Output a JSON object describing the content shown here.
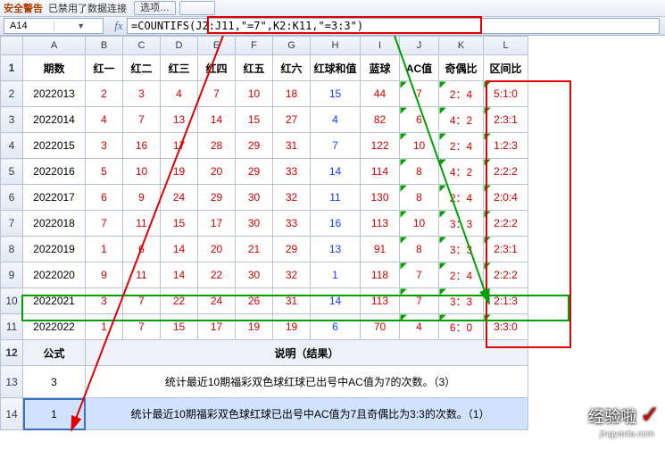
{
  "topbar": {
    "warn_label": "安全警告",
    "msg": "已禁用了数据连接",
    "btn1": "选项…",
    "btn2": ""
  },
  "namebox": "A14",
  "formula": "=COUNTIFS(J2:J11,\"=7\",K2:K11,\"=3:3\")",
  "columns": [
    "A",
    "B",
    "C",
    "D",
    "E",
    "F",
    "G",
    "H",
    "I",
    "J",
    "K",
    "L"
  ],
  "row_numbers": [
    "1",
    "2",
    "3",
    "4",
    "5",
    "6",
    "7",
    "8",
    "9",
    "10",
    "11",
    "12",
    "13",
    "14"
  ],
  "headers": {
    "A": "期数",
    "B": "红一",
    "C": "红二",
    "D": "红三",
    "E": "红四",
    "F": "红五",
    "G": "红六",
    "H": "红球和值",
    "I": "蓝球",
    "J": "AC值",
    "K": "奇偶比",
    "L": "区间比"
  },
  "rows": [
    {
      "A": "2022013",
      "B": "2",
      "C": "3",
      "D": "4",
      "E": "7",
      "F": "10",
      "G": "18",
      "H": "15",
      "I": "44",
      "J": "7",
      "K": "2：4",
      "L": "5:1:0"
    },
    {
      "A": "2022014",
      "B": "4",
      "C": "7",
      "D": "13",
      "E": "14",
      "F": "15",
      "G": "27",
      "H": "4",
      "I": "82",
      "J": "6",
      "K": "4：2",
      "L": "2:3:1"
    },
    {
      "A": "2022015",
      "B": "3",
      "C": "16",
      "D": "17",
      "E": "28",
      "F": "29",
      "G": "31",
      "H": "7",
      "I": "122",
      "J": "10",
      "K": "2：4",
      "L": "1:2:3"
    },
    {
      "A": "2022016",
      "B": "5",
      "C": "10",
      "D": "19",
      "E": "20",
      "F": "29",
      "G": "33",
      "H": "14",
      "I": "114",
      "J": "8",
      "K": "4：2",
      "L": "2:2:2"
    },
    {
      "A": "2022017",
      "B": "6",
      "C": "9",
      "D": "24",
      "E": "29",
      "F": "30",
      "G": "32",
      "H": "11",
      "I": "130",
      "J": "8",
      "K": "2：4",
      "L": "2:0:4"
    },
    {
      "A": "2022018",
      "B": "7",
      "C": "11",
      "D": "15",
      "E": "17",
      "F": "30",
      "G": "33",
      "H": "16",
      "I": "113",
      "J": "10",
      "K": "3：3",
      "L": "2:2:2"
    },
    {
      "A": "2022019",
      "B": "1",
      "C": "6",
      "D": "14",
      "E": "20",
      "F": "21",
      "G": "29",
      "H": "13",
      "I": "91",
      "J": "8",
      "K": "3：3",
      "L": "2:3:1"
    },
    {
      "A": "2022020",
      "B": "9",
      "C": "11",
      "D": "14",
      "E": "22",
      "F": "30",
      "G": "32",
      "H": "1",
      "I": "118",
      "J": "7",
      "K": "2：4",
      "L": "2:2:2"
    },
    {
      "A": "2022021",
      "B": "3",
      "C": "7",
      "D": "22",
      "E": "24",
      "F": "26",
      "G": "31",
      "H": "14",
      "I": "113",
      "J": "7",
      "K": "3：3",
      "L": "2:1:3"
    },
    {
      "A": "2022022",
      "B": "1",
      "C": "7",
      "D": "15",
      "E": "17",
      "F": "19",
      "G": "19",
      "H": "6",
      "I": "70",
      "J": "4",
      "K": "6：0",
      "L": "3:3:0"
    }
  ],
  "row12": {
    "A_label": "公式",
    "desc_label": "说明（结果）"
  },
  "row13": {
    "A": "3",
    "desc": "统计最近10期福彩双色球红球已出号中AC值为7的次数。（3）"
  },
  "row14": {
    "A": "1",
    "desc": "统计最近10期福彩双色球红球已出号中AC值为7且奇偶比为3:3的次数。（1）"
  },
  "watermark": {
    "brand": "经验啦",
    "check": "✓",
    "site": "jingyanla.com"
  }
}
